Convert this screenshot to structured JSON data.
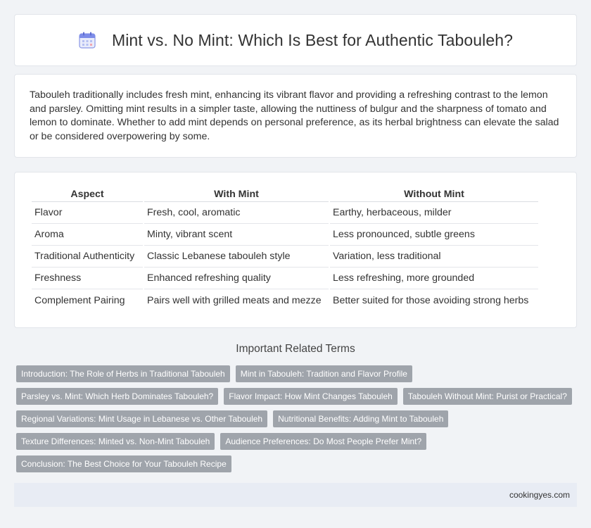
{
  "header": {
    "title": "Mint vs. No Mint: Which Is Best for Authentic Tabouleh?",
    "icon": "calendar-icon",
    "icon_color": "#6b7ee0"
  },
  "intro": {
    "text": "Tabouleh traditionally includes fresh mint, enhancing its vibrant flavor and providing a refreshing contrast to the lemon and parsley. Omitting mint results in a simpler taste, allowing the nuttiness of bulgur and the sharpness of tomato and lemon to dominate. Whether to add mint depends on personal preference, as its herbal brightness can elevate the salad or be considered overpowering by some."
  },
  "table": {
    "headers": [
      "Aspect",
      "With Mint",
      "Without Mint"
    ],
    "rows": [
      [
        "Flavor",
        "Fresh, cool, aromatic",
        "Earthy, herbaceous, milder"
      ],
      [
        "Aroma",
        "Minty, vibrant scent",
        "Less pronounced, subtle greens"
      ],
      [
        "Traditional Authenticity",
        "Classic Lebanese tabouleh style",
        "Variation, less traditional"
      ],
      [
        "Freshness",
        "Enhanced refreshing quality",
        "Less refreshing, more grounded"
      ],
      [
        "Complement Pairing",
        "Pairs well with grilled meats and mezze",
        "Better suited for those avoiding strong herbs"
      ]
    ]
  },
  "related": {
    "title": "Important Related Terms",
    "tags": [
      [
        "Introduction: The Role of Herbs in Traditional Tabouleh",
        "Mint in Tabouleh: Tradition and Flavor Profile"
      ],
      [
        "Parsley vs. Mint: Which Herb Dominates Tabouleh?",
        "Flavor Impact: How Mint Changes Tabouleh",
        "Tabouleh Without Mint: Purist or Practical?"
      ],
      [
        "Regional Variations: Mint Usage in Lebanese vs. Other Tabouleh",
        "Nutritional Benefits: Adding Mint to Tabouleh"
      ],
      [
        "Texture Differences: Minted vs. Non-Mint Tabouleh",
        "Audience Preferences: Do Most People Prefer Mint?"
      ],
      [
        "Conclusion: The Best Choice for Your Tabouleh Recipe"
      ]
    ]
  },
  "footer": {
    "site": "cookingyes.com"
  }
}
